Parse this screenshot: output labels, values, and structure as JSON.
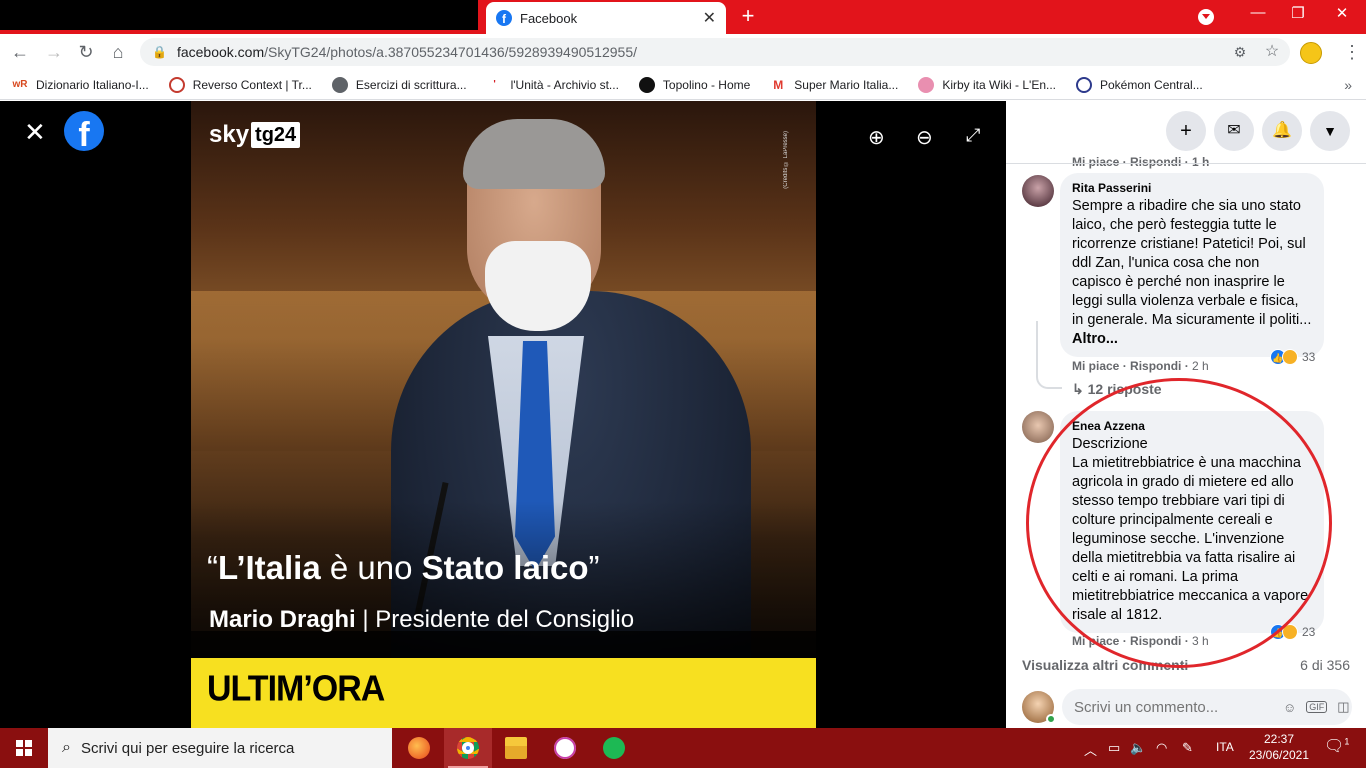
{
  "browser": {
    "tab_title": "Facebook",
    "url_host": "facebook.com",
    "url_path": "/SkyTG24/photos/a.387055234701436/5928939490512955/",
    "bookmarks": [
      {
        "label": "Dizionario Italiano-I...",
        "icon": "wr-icon",
        "color": "#d8491f"
      },
      {
        "label": "Reverso Context | Tr...",
        "icon": "reverso-icon",
        "color": "#c43b2f"
      },
      {
        "label": "Esercizi di scrittura...",
        "icon": "globe-icon",
        "color": "#5f6368"
      },
      {
        "label": "l'Unità - Archivio st...",
        "icon": "unita-icon",
        "color": "#d61f26"
      },
      {
        "label": "Topolino - Home",
        "icon": "mickey-icon",
        "color": "#111111"
      },
      {
        "label": "Super Mario Italia...",
        "icon": "mushroom-icon",
        "color": "#e03a2f"
      },
      {
        "label": "Kirby ita Wiki - L'En...",
        "icon": "kirby-icon",
        "color": "#e98fb0"
      },
      {
        "label": "Pokémon Central...",
        "icon": "pokeball-icon",
        "color": "#2d3a8c"
      }
    ]
  },
  "photo": {
    "brand": "sky",
    "brand_tag": "tg24",
    "credit": "(Credits © LaPresse)",
    "quote_open": "“",
    "quote_bold1": "L’Italia",
    "quote_mid": " è uno ",
    "quote_bold2": "Stato laico",
    "quote_close": "”",
    "byline_name": "Mario Draghi",
    "byline_role": " | Presidente del Consiglio",
    "banner": "ULTIM’ORA"
  },
  "comments": [
    {
      "author": "Rita Passerini",
      "text": "Sempre a ribadire che sia uno stato laico, che però festeggia tutte le ricorrenze cristiane! Patetici! Poi, sul ddl Zan, l'unica cosa che non capisco è perché non inasprire le leggi sulla violenza verbale e fisica, in generale. Ma sicuramente il politi...",
      "more": "Altro...",
      "like": "Mi piace",
      "reply": "Rispondi",
      "time": "2 h",
      "reactions": "33",
      "replies": "12 risposte"
    },
    {
      "author": "Enea Azzena",
      "text": "Descrizione\nLa mietitrebbiatrice è una macchina agricola in grado di mietere ed allo stesso tempo trebbiare vari tipi di colture principalmente cereali e leguminose secche. L'invenzione della mietitrebbia va fatta risalire ai celti e ai romani. La prima mietitrebbiatrice meccanica a vapore risale al 1812.",
      "like": "Mi piace",
      "reply": "Rispondi",
      "time": "3 h",
      "reactions": "23"
    }
  ],
  "panel": {
    "cut_row": "Mi piace · Rispondi · 1 h",
    "view_more": "Visualizza altri commenti",
    "count": "6 di 356",
    "comment_placeholder": "Scrivi un commento..."
  },
  "taskbar": {
    "search_placeholder": "Scrivi qui per eseguire la ricerca",
    "lang": "ITA",
    "time": "22:37",
    "date": "23/06/2021",
    "notifications": "1"
  }
}
